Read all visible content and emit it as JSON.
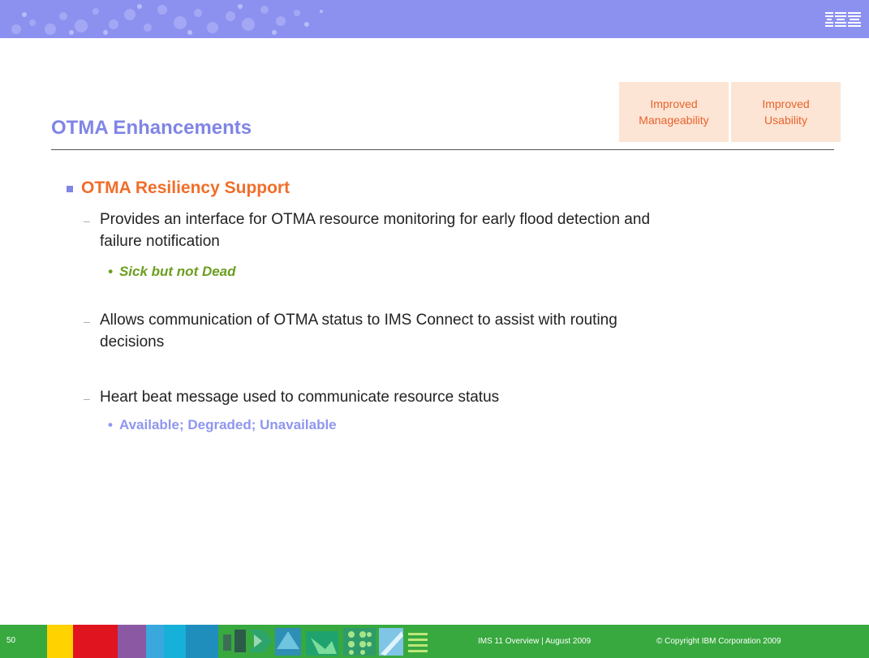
{
  "header": {
    "logo": "IBM",
    "logo_color": "#ffffff",
    "band_color": "#8c91f0"
  },
  "title": "OTMA Enhancements",
  "tags": [
    {
      "line1": "Improved",
      "line2": "Manageability"
    },
    {
      "line1": "Improved",
      "line2": "Usability"
    }
  ],
  "section": {
    "heading": "OTMA Resiliency Support",
    "items": [
      {
        "line1": "Provides an interface for OTMA resource monitoring for early flood detection and",
        "line2": "failure notification",
        "sub": "Sick but not Dead"
      },
      {
        "line1": "Allows communication of OTMA status to IMS Connect to assist with routing",
        "line2": "decisions"
      },
      {
        "line1": "Heart beat message used to communicate resource status",
        "sub": "Available; Degraded; Unavailable"
      }
    ]
  },
  "footer": {
    "page_number": "50",
    "course": "IMS 11 Overview",
    "separator": "|",
    "date": "August 2009",
    "copyright": "© Copyright IBM Corporation 2009"
  },
  "colors": {
    "title": "#8085e6",
    "heading": "#f06e2a",
    "tag_bg": "#fce5d4",
    "tag_text": "#e8622c",
    "sub_green": "#6b9e1f",
    "sub_blue": "#8f96ef",
    "footer": "#38a93f"
  }
}
